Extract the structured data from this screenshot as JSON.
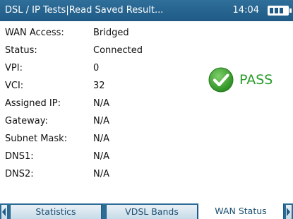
{
  "header": {
    "title": "DSL / IP Tests|Read Saved Result...",
    "time": "14:04",
    "battery_level": 1.0
  },
  "fields": [
    {
      "label": "WAN Access:",
      "value": "Bridged"
    },
    {
      "label": "Status:",
      "value": "Connected"
    },
    {
      "label": "VPI:",
      "value": "0"
    },
    {
      "label": "VCI:",
      "value": "32"
    },
    {
      "label": "Assigned IP:",
      "value": "N/A"
    },
    {
      "label": "Gateway:",
      "value": "N/A"
    },
    {
      "label": "Subnet Mask:",
      "value": "N/A"
    },
    {
      "label": "DNS1:",
      "value": "N/A"
    },
    {
      "label": "DNS2:",
      "value": "N/A"
    }
  ],
  "result": {
    "text": "PASS",
    "icon": "check-circle-icon",
    "color": "#2a9b2a"
  },
  "tabs": [
    {
      "label": "Statistics",
      "active": false
    },
    {
      "label": "VDSL Bands",
      "active": false
    },
    {
      "label": "WAN Status",
      "active": true
    }
  ],
  "colors": {
    "titlebar": "#1e5a85",
    "tabbar": "#2c6d96",
    "pass_green": "#2a9b2a"
  }
}
